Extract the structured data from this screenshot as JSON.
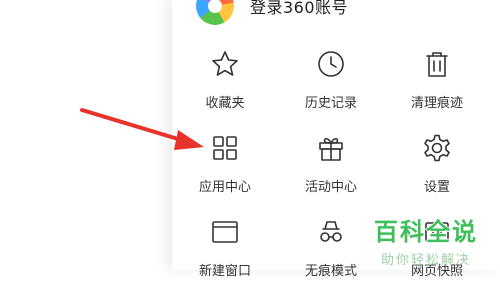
{
  "header": {
    "login_text": "登录360账号"
  },
  "menu": {
    "items": [
      {
        "label": "收藏夹",
        "icon": "star-icon"
      },
      {
        "label": "历史记录",
        "icon": "clock-icon"
      },
      {
        "label": "清理痕迹",
        "icon": "trash-icon"
      },
      {
        "label": "应用中心",
        "icon": "grid-icon"
      },
      {
        "label": "活动中心",
        "icon": "gift-icon"
      },
      {
        "label": "设置",
        "icon": "gear-icon"
      },
      {
        "label": "新建窗口",
        "icon": "window-icon"
      },
      {
        "label": "无痕模式",
        "icon": "incognito-icon"
      },
      {
        "label": "网页快照",
        "icon": "snapshot-icon"
      }
    ]
  },
  "watermark": {
    "title": "百科全说",
    "subtitle": "助你轻松解决"
  },
  "colors": {
    "arrow": "#e8322b",
    "watermark": "#3fbf5a",
    "icon_stroke": "#333333"
  }
}
